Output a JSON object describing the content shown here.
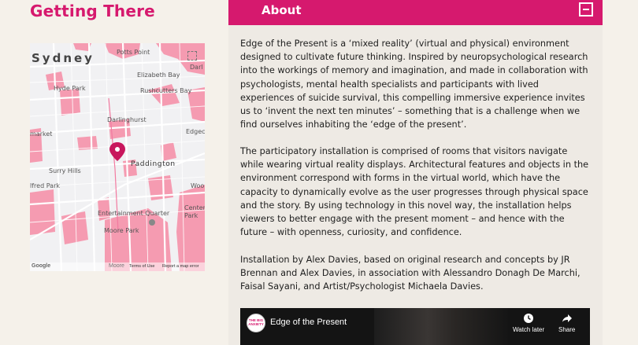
{
  "getting_there": {
    "heading": "Getting There"
  },
  "map": {
    "labels": {
      "sydney": "Sydney",
      "potts_point": "Potts Point",
      "elizabeth_bay": "Elizabeth Bay",
      "darl": "Darl",
      "hyde_park": "Hyde Park",
      "rushcutters_bay": "Rushcutters Bay",
      "darlinghurst": "Darlinghurst",
      "market": "market",
      "edgec": "Edgec",
      "paddington": "Paddington",
      "surry_hills": "Surry Hills",
      "alfred_park": "lfred Park",
      "woo": "Woo",
      "entertainment_quarter": "Entertainment Quarter",
      "centennial_park": "Centennial Park",
      "moore_park": "Moore Park"
    },
    "footer": {
      "google": "Google",
      "moore": "Moore",
      "terms": "Terms of Use",
      "report": "Report a map error"
    },
    "colors": {
      "park": "#f59bb1",
      "pin": "#c8175d"
    }
  },
  "about": {
    "title": "About",
    "paragraphs": [
      "Edge of the Present is a ‘mixed reality’ (virtual and physical) environment designed to cultivate future thinking. Inspired by neuropsychological research into the workings of memory and imagination, and made in collaboration with psychologists, mental health specialists and participants with lived experiences of suicide survival, this compelling immersive experience invites us to ‘invent the next ten minutes’ – something that is a challenge when we find ourselves inhabiting the ‘edge of the present’.",
      "The participatory installation is comprised of rooms that visitors navigate while wearing virtual reality displays. Architectural features and objects in the environment correspond with forms in the virtual world, which have the capacity to dynamically evolve as the user progresses through physical space and the story. By using technology in this novel way, the installation helps viewers to better engage with the present moment – and hence with the future – with openness, curiosity, and confidence.",
      "Installation by Alex Davies, based on original research and concepts by JR Brennan and Alex Davies, in association with Alessandro Donagh De Marchi, Faisal Sayani, and Artist/Psychologist Michaela Davies."
    ]
  },
  "video": {
    "logo_text": "THE BIG ANXIETY",
    "title": "Edge of the Present",
    "watch_later": "Watch later",
    "share": "Share"
  }
}
